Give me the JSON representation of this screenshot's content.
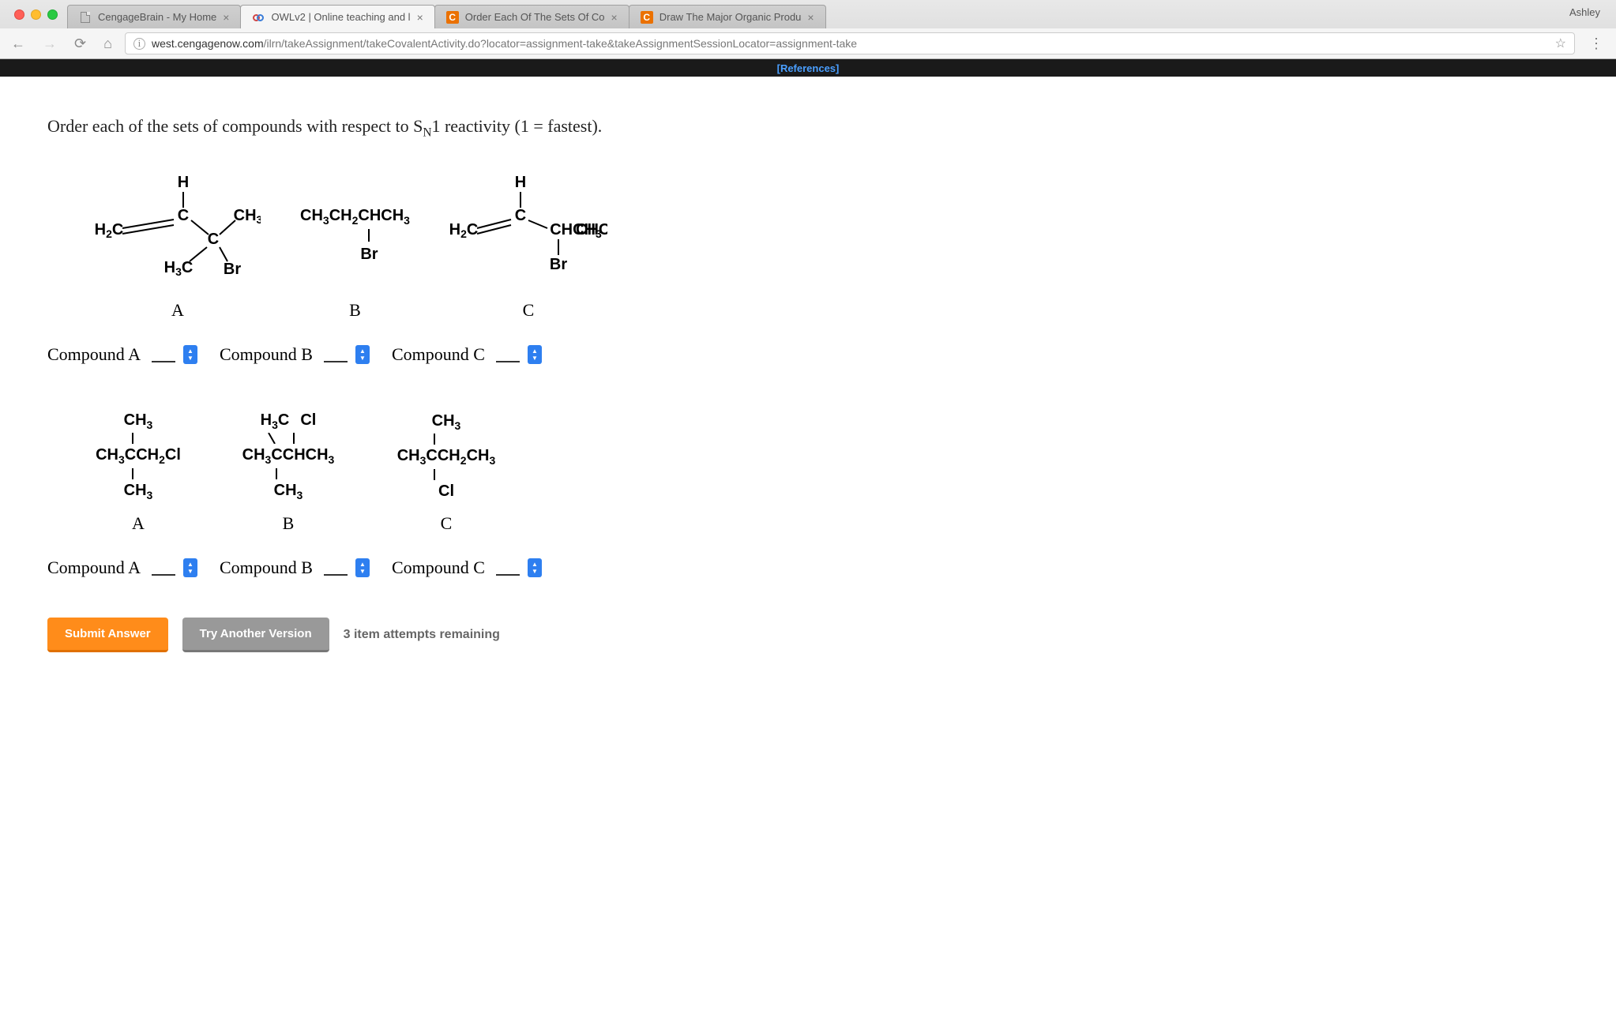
{
  "browser": {
    "user": "Ashley",
    "tabs": [
      {
        "title": "CengageBrain - My Home",
        "active": false,
        "favicon": "file"
      },
      {
        "title": "OWLv2 | Online teaching and l",
        "active": true,
        "favicon": "owl"
      },
      {
        "title": "Order Each Of The Sets Of Co",
        "active": false,
        "favicon": "chegg"
      },
      {
        "title": "Draw The Major Organic Produ",
        "active": false,
        "favicon": "chegg"
      }
    ],
    "url_domain": "west.cengagenow.com",
    "url_path": "/ilrn/takeAssignment/takeCovalentActivity.do?locator=assignment-take&takeAssignmentSessionLocator=assignment-take"
  },
  "topbar": {
    "references_label": "[References]"
  },
  "question": {
    "prompt_before": "Order each of the sets of compounds with respect to S",
    "prompt_sub": "N",
    "prompt_after": "1 reactivity (1 = fastest)."
  },
  "set1": {
    "compounds": {
      "A": {
        "label": "A"
      },
      "B": {
        "label": "B",
        "formula_line1": "CH3CH2CHCH3",
        "formula_line2": "Br"
      },
      "C": {
        "label": "C"
      }
    },
    "selectors": {
      "a_label": "Compound A",
      "b_label": "Compound B",
      "c_label": "Compound C"
    }
  },
  "set2": {
    "compounds": {
      "A": {
        "label": "A"
      },
      "B": {
        "label": "B"
      },
      "C": {
        "label": "C"
      }
    },
    "selectors": {
      "a_label": "Compound A",
      "b_label": "Compound B",
      "c_label": "Compound C"
    }
  },
  "buttons": {
    "submit": "Submit Answer",
    "try_another": "Try Another Version",
    "attempts": "3 item attempts remaining"
  }
}
